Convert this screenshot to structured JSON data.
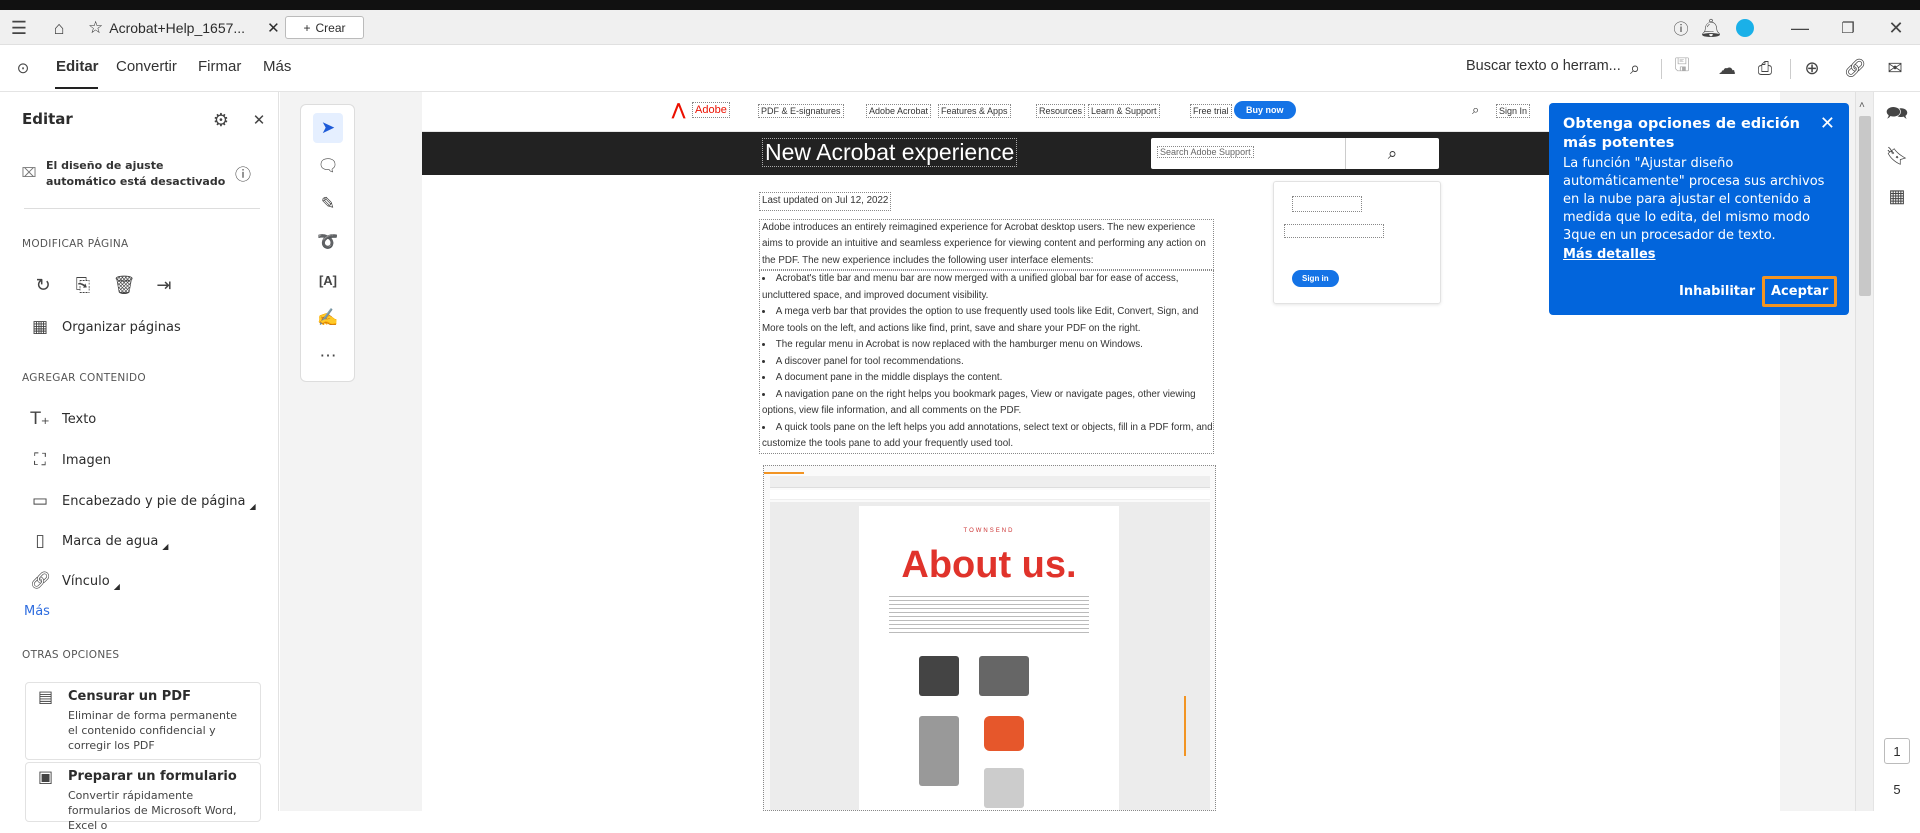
{
  "tabbar": {
    "tab_title": "Acrobat+Help_1657...",
    "new_tab_label": "Crear"
  },
  "menubar": {
    "tabs": [
      "Editar",
      "Convertir",
      "Firmar",
      "Más"
    ],
    "search_placeholder": "Buscar texto o herram..."
  },
  "left_panel": {
    "title": "Editar",
    "auto_layout_notice": "El diseño de ajuste automático está desactivado",
    "section_modify": "MODIFICAR PÁGINA",
    "organize_pages": "Organizar páginas",
    "section_add": "AGREGAR CONTENIDO",
    "add_items": [
      "Texto",
      "Imagen",
      "Encabezado y pie de página",
      "Marca de agua",
      "Vínculo"
    ],
    "more_link": "Más",
    "section_other": "OTRAS OPCIONES",
    "cards": [
      {
        "title": "Censurar un PDF",
        "desc": "Eliminar de forma permanente el contenido confidencial y corregir los PDF"
      },
      {
        "title": "Preparar un formulario",
        "desc": "Convertir rápidamente formularios de Microsoft Word, Excel o"
      }
    ]
  },
  "document": {
    "nav": {
      "brand": "Adobe",
      "items": [
        "PDF & E-signatures",
        "Adobe Acrobat",
        "Features & Apps",
        "Resources",
        "Learn & Support",
        "Free trial"
      ],
      "buy_now": "Buy now",
      "sign_in": "Sign In"
    },
    "banner_title": "New Acrobat experience",
    "search_placeholder": "Search Adobe Support",
    "sign_in_card_button": "Sign in",
    "last_updated": "Last updated on Jul 12, 2022",
    "intro": "Adobe introduces an entirely reimagined experience for Acrobat desktop users. The new experience aims to provide an intuitive and seamless experience for viewing content and performing any action on the PDF. The new experience includes the following user interface elements:",
    "bullets": [
      "Acrobat's title bar and menu bar are now merged with a unified global bar for ease of access, uncluttered space, and improved document visibility.",
      "A mega verb bar that provides the option to use frequently used tools like Edit, Convert, Sign, and More tools on the left, and actions like find, print, save and share your PDF on the right.",
      "The regular menu in Acrobat is now replaced with the hamburger menu on Windows.",
      "A discover panel for tool recommendations.",
      "A document pane in the middle displays the content.",
      "A navigation pane on the right helps you bookmark pages, View or navigate pages, other viewing options, view file information, and all comments on the PDF.",
      "A quick tools pane on the left helps you add annotations, select text or objects, fill in a PDF form, and customize the tools pane to add your frequently used tool."
    ],
    "screenshot": {
      "brand": "TOWNSEND",
      "heading": "About us."
    }
  },
  "popup": {
    "title": "Obtenga opciones de edición más potentes",
    "body": "La función \"Ajustar diseño automáticamente\" procesa sus archivos en la nube para ajustar el contenido a medida que lo edita, del mismo modo 3que en un procesador de texto.",
    "link": "Más detalles",
    "disable": "Inhabilitar",
    "accept": "Aceptar"
  },
  "page_nav": {
    "current": "1",
    "total": "5"
  },
  "colors": {
    "accent": "#0265dc",
    "adobe_red": "#eb1000",
    "focus_orange": "#f29423"
  }
}
